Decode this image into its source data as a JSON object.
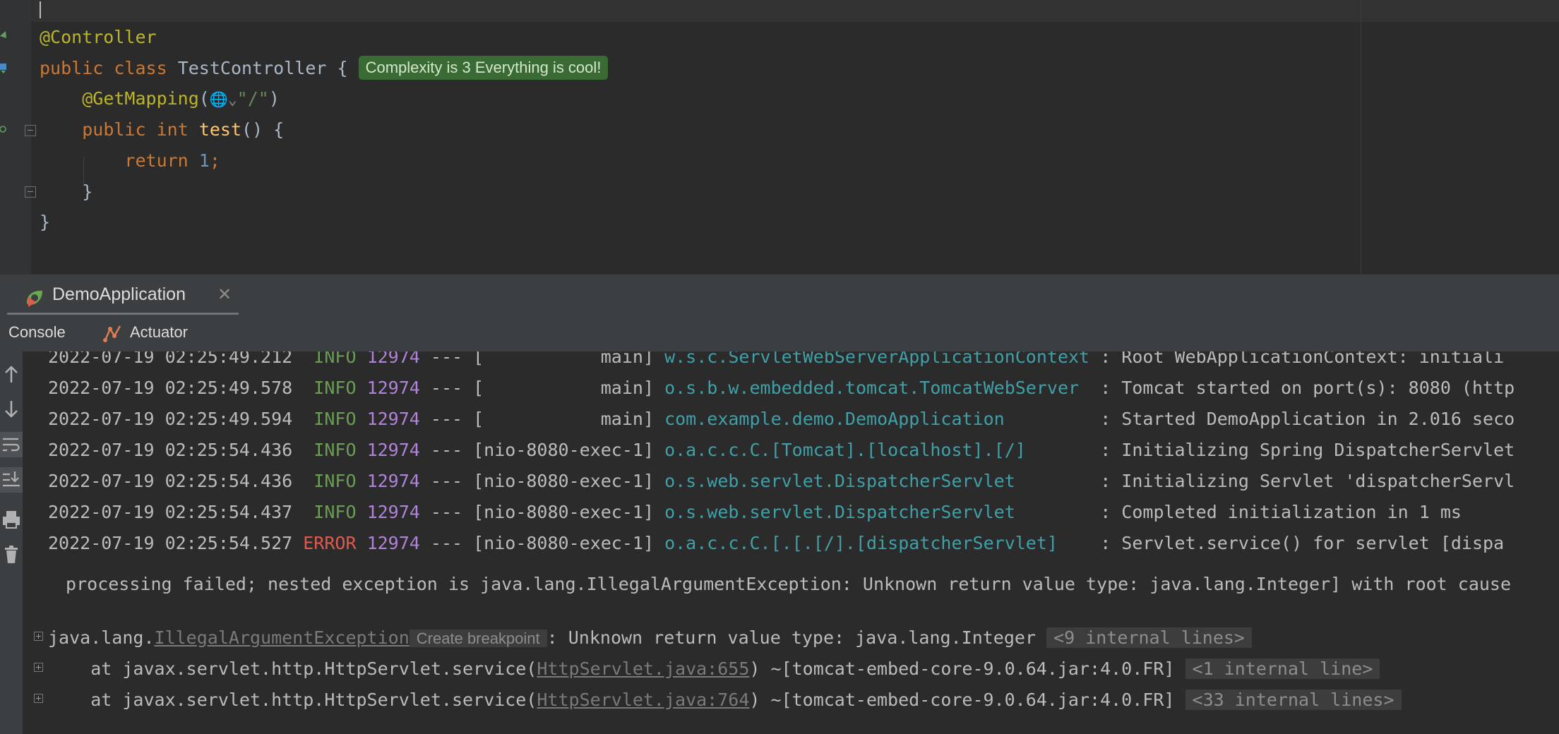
{
  "editor": {
    "lines": {
      "l1_annotation": "@Controller",
      "l2_kw_public": "public",
      "l2_kw_class": "class",
      "l2_classname": "TestController",
      "l2_brace": "{",
      "l2_hint": "Complexity is 3 Everything is cool!",
      "l3_annotation": "@GetMapping",
      "l3_open": "(",
      "l3_inlay": "🌐⌄",
      "l3_string": "\"/\"",
      "l3_close": ")",
      "l4_kw_public": "public",
      "l4_kw_int": "int",
      "l4_method": "test",
      "l4_rest": "() {",
      "l5_kw_return": "return",
      "l5_number": "1",
      "l5_semicolon": ";",
      "l6_close": "}",
      "l7_close": "}"
    }
  },
  "run_panel": {
    "tab_label": "DemoApplication",
    "close_glyph": "✕",
    "subtabs": {
      "console": "Console",
      "actuator": "Actuator"
    }
  },
  "console": {
    "log_lines": [
      {
        "ts": "2022-07-19 02:25:49.212",
        "level": " INFO",
        "pid": "12974",
        "sep": "---",
        "thread": "[           main]",
        "logger": "w.s.c.ServletWebServerApplicationContext",
        "msg": ": Root WebApplicationContext: initiali"
      },
      {
        "ts": "2022-07-19 02:25:49.578",
        "level": " INFO",
        "pid": "12974",
        "sep": "---",
        "thread": "[           main]",
        "logger": "o.s.b.w.embedded.tomcat.TomcatWebServer ",
        "msg": ": Tomcat started on port(s): 8080 (http"
      },
      {
        "ts": "2022-07-19 02:25:49.594",
        "level": " INFO",
        "pid": "12974",
        "sep": "---",
        "thread": "[           main]",
        "logger": "com.example.demo.DemoApplication        ",
        "msg": ": Started DemoApplication in 2.016 seco"
      },
      {
        "ts": "2022-07-19 02:25:54.436",
        "level": " INFO",
        "pid": "12974",
        "sep": "---",
        "thread": "[nio-8080-exec-1]",
        "logger": "o.a.c.c.C.[Tomcat].[localhost].[/]      ",
        "msg": ": Initializing Spring DispatcherServlet"
      },
      {
        "ts": "2022-07-19 02:25:54.436",
        "level": " INFO",
        "pid": "12974",
        "sep": "---",
        "thread": "[nio-8080-exec-1]",
        "logger": "o.s.web.servlet.DispatcherServlet       ",
        "msg": ": Initializing Servlet 'dispatcherServl"
      },
      {
        "ts": "2022-07-19 02:25:54.437",
        "level": " INFO",
        "pid": "12974",
        "sep": "---",
        "thread": "[nio-8080-exec-1]",
        "logger": "o.s.web.servlet.DispatcherServlet       ",
        "msg": ": Completed initialization in 1 ms"
      },
      {
        "ts": "2022-07-19 02:25:54.527",
        "level": "ERROR",
        "pid": "12974",
        "sep": "---",
        "thread": "[nio-8080-exec-1]",
        "logger": "o.a.c.c.C.[.[.[/].[dispatcherServlet]   ",
        "msg": ": Servlet.service() for servlet [dispa"
      }
    ],
    "continuation": " processing failed; nested exception is java.lang.IllegalArgumentException: Unknown return value type: java.lang.Integer] with root cause",
    "exception": {
      "prefix": "java.lang.",
      "link": "IllegalArgumentException",
      "breakpoint_chip": "Create breakpoint",
      "message": ": Unknown return value type: java.lang.Integer",
      "internal": "<9 internal lines>"
    },
    "stack_frames": [
      {
        "prefix": "    at javax.servlet.http.HttpServlet.service(",
        "link": "HttpServlet.java:655",
        "suffix": ") ~[tomcat-embed-core-9.0.64.jar:4.0.FR]",
        "internal": "<1 internal line>"
      },
      {
        "prefix": "    at javax.servlet.http.HttpServlet.service(",
        "link": "HttpServlet.java:764",
        "suffix": ") ~[tomcat-embed-core-9.0.64.jar:4.0.FR]",
        "internal": "<33 internal lines>"
      }
    ]
  },
  "icons": {
    "toolbar": [
      "arrow-up-icon",
      "arrow-down-icon",
      "soft-wrap-icon",
      "scroll-to-end-icon",
      "print-icon",
      "trash-icon"
    ],
    "run_tab": "spring-boot-run-icon",
    "actuator": "actuator-icon"
  },
  "colors": {
    "editor_bg": "#2b2b2b",
    "panel_bg": "#3c3f41",
    "info": "#6a9e52",
    "error": "#e05a4b",
    "pid": "#b083d8",
    "logger": "#3fa0a8",
    "hint_bg": "#3a6b35"
  }
}
